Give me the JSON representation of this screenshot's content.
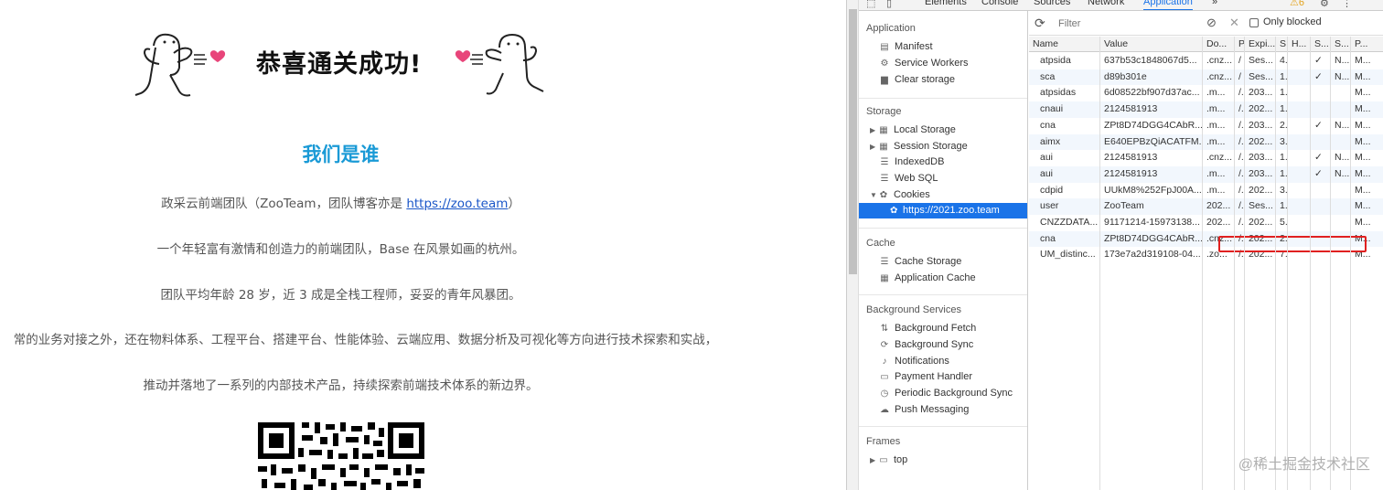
{
  "page": {
    "hero_title": "恭喜通关成功!",
    "section_title": "我们是谁",
    "intro_prefix": "政采云前端团队（ZooTeam，团队博客亦是 ",
    "blog_link": "https://zoo.team",
    "intro_suffix": "）",
    "line2": "一个年轻富有激情和创造力的前端团队，Base 在风景如画的杭州。",
    "line3": "团队平均年龄 28 岁，近 3 成是全栈工程师，妥妥的青年风暴团。",
    "line4": "常的业务对接之外，还在物料体系、工程平台、搭建平台、性能体验、云端应用、数据分析及可视化等方向进行技术探索和实战，",
    "line5": "推动并落地了一系列的内部技术产品，持续探索前端技术体系的新边界。"
  },
  "devtools": {
    "tabs": [
      "Elements",
      "Console",
      "Sources",
      "Network",
      "Application"
    ],
    "active_tab": "Application",
    "more": "»",
    "warnings": "⚠6",
    "sidebar": {
      "application_header": "Application",
      "application_items": [
        "Manifest",
        "Service Workers",
        "Clear storage"
      ],
      "storage_header": "Storage",
      "storage_items": [
        "Local Storage",
        "Session Storage",
        "IndexedDB",
        "Web SQL",
        "Cookies"
      ],
      "cookie_origin": "https://2021.zoo.team",
      "cache_header": "Cache",
      "cache_items": [
        "Cache Storage",
        "Application Cache"
      ],
      "bg_header": "Background Services",
      "bg_items": [
        "Background Fetch",
        "Background Sync",
        "Notifications",
        "Payment Handler",
        "Periodic Background Sync",
        "Push Messaging"
      ],
      "frames_header": "Frames",
      "frames_items": [
        "top"
      ]
    },
    "toolbar": {
      "filter_placeholder": "Filter",
      "only_blocked": "Only blocked"
    },
    "columns": [
      "Name",
      "Value",
      "Do...",
      "P",
      "Expi...",
      "S",
      "H...",
      "S...",
      "S...",
      "P..."
    ],
    "rows": [
      [
        "atpsida",
        "637b53c1848067d5...",
        ".cnz...",
        "/",
        "Ses...",
        "4.",
        "",
        "✓",
        "N...",
        "M..."
      ],
      [
        "sca",
        "d89b301e",
        ".cnz...",
        "/",
        "Ses...",
        "1.",
        "",
        "✓",
        "N...",
        "M..."
      ],
      [
        "atpsidas",
        "6d08522bf907d37ac...",
        ".m...",
        "/.",
        "203...",
        "1.",
        "",
        "",
        "",
        "M..."
      ],
      [
        "cnaui",
        "2124581913",
        ".m...",
        "/.",
        "202...",
        "1.",
        "",
        "",
        "",
        "M..."
      ],
      [
        "cna",
        "ZPt8D74DGG4CAbR...",
        ".m...",
        "/.",
        "203...",
        "2.",
        "",
        "✓",
        "N...",
        "M..."
      ],
      [
        "aimx",
        "E640EPBzQiACATFM...",
        ".m...",
        "/.",
        "202...",
        "3.",
        "",
        "",
        "",
        "M..."
      ],
      [
        "aui",
        "2124581913",
        ".cnz...",
        "/.",
        "203...",
        "1.",
        "",
        "✓",
        "N...",
        "M..."
      ],
      [
        "aui",
        "2124581913",
        ".m...",
        "/.",
        "203...",
        "1.",
        "",
        "✓",
        "N...",
        "M..."
      ],
      [
        "cdpid",
        "UUkM8%252FpJ00A...",
        ".m...",
        "/.",
        "202...",
        "3.",
        "",
        "",
        "",
        "M..."
      ],
      [
        "user",
        "ZooTeam",
        "202...",
        "/.",
        "Ses...",
        "1.",
        "",
        "",
        "",
        "M..."
      ],
      [
        "CNZZDATA...",
        "91171214-15973138...",
        "202...",
        "/.",
        "202...",
        "5.",
        "",
        "",
        "",
        "M..."
      ],
      [
        "cna",
        "ZPt8D74DGG4CAbR...",
        ".cnz...",
        "/.",
        "202...",
        "2.",
        "",
        "",
        "",
        "M..."
      ],
      [
        "UM_distinc...",
        "173e7a2d319108-04...",
        ".zo...",
        "/.",
        "202...",
        "7.",
        "",
        "",
        "",
        "M..."
      ]
    ],
    "watermark": "@稀土掘金技术社区"
  }
}
